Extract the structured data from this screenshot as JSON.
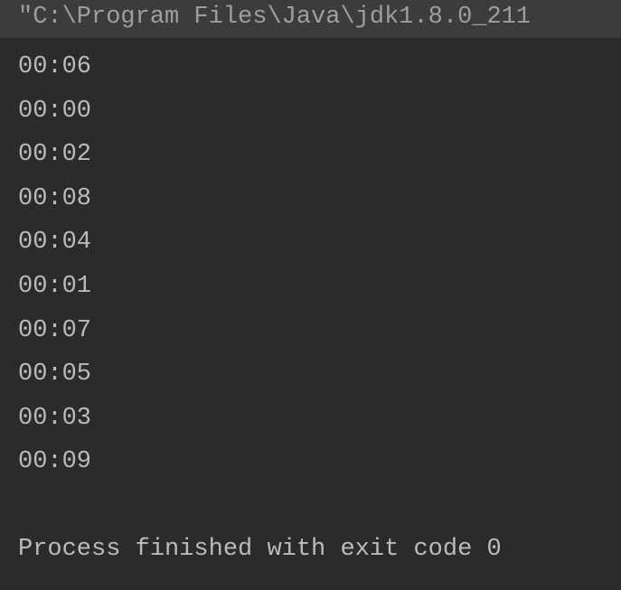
{
  "console": {
    "command": "\"C:\\Program Files\\Java\\jdk1.8.0_211",
    "output": [
      "00:06",
      "00:00",
      "00:02",
      "00:08",
      "00:04",
      "00:01",
      "00:07",
      "00:05",
      "00:03",
      "00:09"
    ],
    "exit_message": "Process finished with exit code 0"
  }
}
